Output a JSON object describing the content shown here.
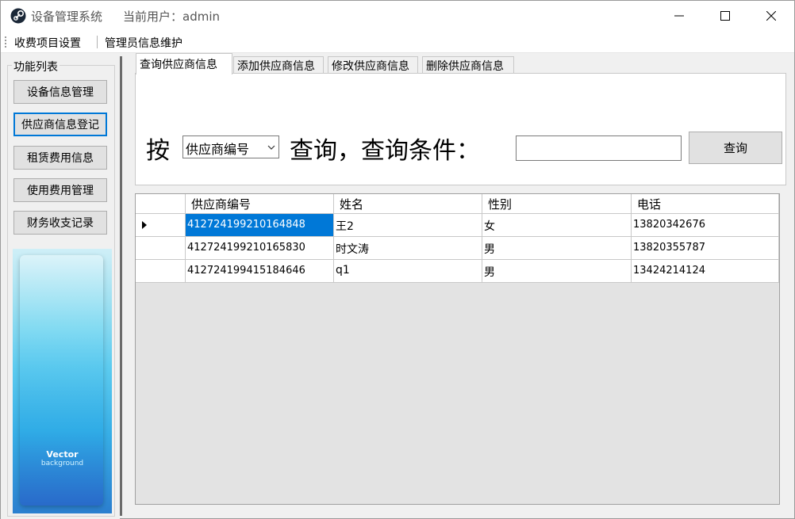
{
  "window": {
    "title": "设备管理系统",
    "user_label": "当前用户：admin"
  },
  "menu": {
    "items": [
      "收费项目设置",
      "管理员信息维护"
    ]
  },
  "sidebar": {
    "group_title": "功能列表",
    "buttons": [
      "设备信息管理",
      "供应商信息登记",
      "租赁费用信息",
      "使用费用管理",
      "财务收支记录"
    ],
    "banner": {
      "title": "Vector",
      "subtitle": "background"
    }
  },
  "tabs": [
    "查询供应商信息",
    "添加供应商信息",
    "修改供应商信息",
    "删除供应商信息"
  ],
  "search": {
    "by_label": "按",
    "field_selected": "供应商编号",
    "condition_label": "查询，查询条件：",
    "condition_value": "",
    "button_label": "查询"
  },
  "grid": {
    "columns": [
      "供应商编号",
      "姓名",
      "性别",
      "电话"
    ],
    "rows": [
      [
        "412724199210164848",
        "王2",
        "女",
        "13820342676"
      ],
      [
        "412724199210165830",
        "时文涛",
        "男",
        "13820355787"
      ],
      [
        "412724199415184646",
        "q1",
        "男",
        "13424214124"
      ]
    ],
    "selected_row": 0
  },
  "colors": {
    "accent": "#0078d7",
    "button_face": "#e1e1e1",
    "window_bg": "#f0f0f0"
  }
}
